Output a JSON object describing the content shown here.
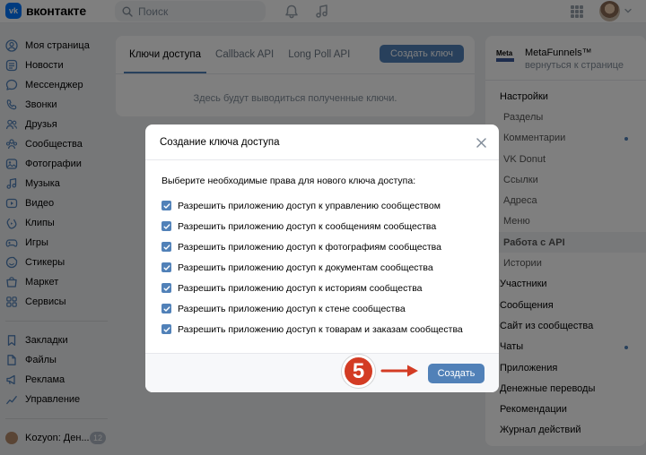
{
  "header": {
    "logo_mark": "vk",
    "logo_text": "вконтакте",
    "search_placeholder": "Поиск",
    "icons": [
      "search-icon",
      "bell-icon",
      "music-icon",
      "apps-grid-icon",
      "chevron-down-icon"
    ]
  },
  "sidebar": {
    "items": [
      {
        "label": "Моя страница",
        "icon": "user-circle-icon"
      },
      {
        "label": "Новости",
        "icon": "news-icon"
      },
      {
        "label": "Мессенджер",
        "icon": "message-icon"
      },
      {
        "label": "Звонки",
        "icon": "phone-icon"
      },
      {
        "label": "Друзья",
        "icon": "friends-icon"
      },
      {
        "label": "Сообщества",
        "icon": "community-icon"
      },
      {
        "label": "Фотографии",
        "icon": "photo-icon"
      },
      {
        "label": "Музыка",
        "icon": "music-icon"
      },
      {
        "label": "Видео",
        "icon": "video-icon"
      },
      {
        "label": "Клипы",
        "icon": "clips-icon"
      },
      {
        "label": "Игры",
        "icon": "gamepad-icon"
      },
      {
        "label": "Стикеры",
        "icon": "sticker-icon"
      },
      {
        "label": "Маркет",
        "icon": "market-icon"
      },
      {
        "label": "Сервисы",
        "icon": "services-icon"
      }
    ],
    "items2": [
      {
        "label": "Закладки",
        "icon": "bookmark-icon"
      },
      {
        "label": "Файлы",
        "icon": "file-icon"
      },
      {
        "label": "Реклама",
        "icon": "ads-icon"
      },
      {
        "label": "Управление",
        "icon": "manage-icon"
      }
    ],
    "profile": {
      "label": "Kozyon: Ден...",
      "badge": "12"
    }
  },
  "main": {
    "tabs": [
      {
        "label": "Ключи доступа",
        "active": true
      },
      {
        "label": "Callback API",
        "active": false
      },
      {
        "label": "Long Poll API",
        "active": false
      }
    ],
    "create_button": "Создать ключ",
    "empty_text": "Здесь будут выводиться полученные ключи."
  },
  "right": {
    "group_logo_text": "Meta",
    "group_name": "MetaFunnels™",
    "group_back": "вернуться к странице",
    "items": [
      {
        "label": "Настройки",
        "sub": false,
        "dot": false,
        "active": false
      },
      {
        "label": "Разделы",
        "sub": true,
        "dot": false,
        "active": false
      },
      {
        "label": "Комментарии",
        "sub": true,
        "dot": true,
        "active": false
      },
      {
        "label": "VK Donut",
        "sub": true,
        "dot": false,
        "active": false
      },
      {
        "label": "Ссылки",
        "sub": true,
        "dot": false,
        "active": false
      },
      {
        "label": "Адреса",
        "sub": true,
        "dot": false,
        "active": false
      },
      {
        "label": "Меню",
        "sub": true,
        "dot": false,
        "active": false
      },
      {
        "label": "Работа с API",
        "sub": true,
        "dot": false,
        "active": true
      },
      {
        "label": "Истории",
        "sub": true,
        "dot": false,
        "active": false
      },
      {
        "label": "Участники",
        "sub": false,
        "dot": false,
        "active": false
      },
      {
        "label": "Сообщения",
        "sub": false,
        "dot": false,
        "active": false
      },
      {
        "label": "Сайт из сообщества",
        "sub": false,
        "dot": false,
        "active": false
      },
      {
        "label": "Чаты",
        "sub": false,
        "dot": true,
        "active": false
      },
      {
        "label": "Приложения",
        "sub": false,
        "dot": false,
        "active": false
      },
      {
        "label": "Денежные переводы",
        "sub": false,
        "dot": false,
        "active": false
      },
      {
        "label": "Рекомендации",
        "sub": false,
        "dot": false,
        "active": false
      },
      {
        "label": "Журнал действий",
        "sub": false,
        "dot": false,
        "active": false
      }
    ]
  },
  "modal": {
    "title": "Создание ключа доступа",
    "prompt": "Выберите необходимые права для нового ключа доступа:",
    "permissions": [
      {
        "label": "Разрешить приложению доступ к управлению сообществом",
        "checked": true
      },
      {
        "label": "Разрешить приложению доступ к сообщениям сообщества",
        "checked": true
      },
      {
        "label": "Разрешить приложению доступ к фотографиям сообщества",
        "checked": true
      },
      {
        "label": "Разрешить приложению доступ к документам сообщества",
        "checked": true
      },
      {
        "label": "Разрешить приложению доступ к историям сообщества",
        "checked": true
      },
      {
        "label": "Разрешить приложению доступ к стене сообщества",
        "checked": true
      },
      {
        "label": "Разрешить приложению доступ к товарам и заказам сообщества",
        "checked": true
      }
    ],
    "submit_button": "Создать"
  },
  "annotation": {
    "step": "5"
  },
  "colors": {
    "accent": "#5181b8",
    "brand": "#0077ff",
    "annotation": "#d33c24"
  }
}
